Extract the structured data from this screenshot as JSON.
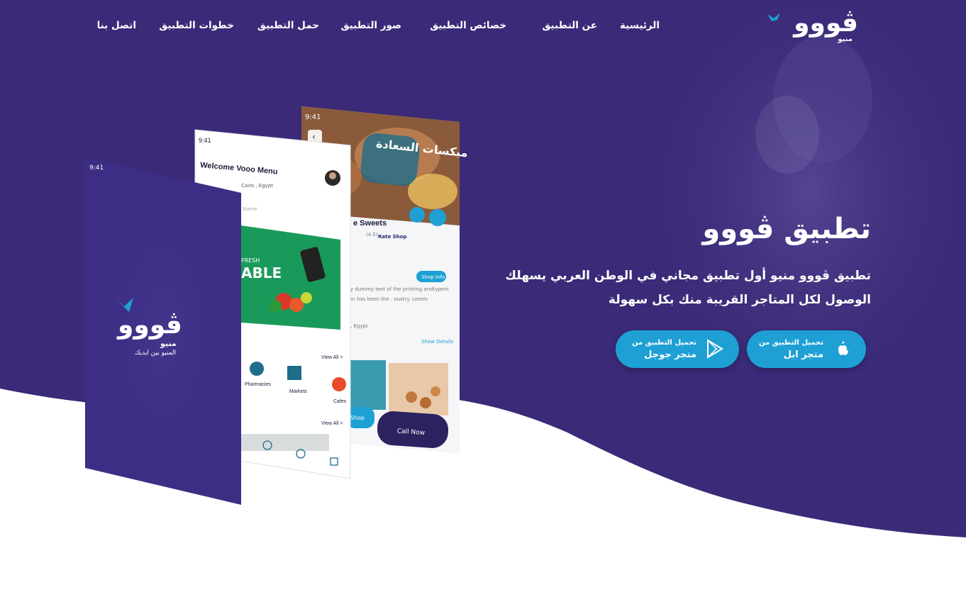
{
  "colors": {
    "brand_purple": "#3a2a78",
    "accent_blue": "#1ea0d4",
    "white": "#ffffff"
  },
  "logo": {
    "text": "ڤووو",
    "subtext": "منيو",
    "icon": "bird-icon"
  },
  "nav": {
    "items": [
      {
        "label": "الرئيسية"
      },
      {
        "label": "عن التطبيق"
      },
      {
        "label": "خصائص التطبيق"
      },
      {
        "label": "صور التطبيق"
      },
      {
        "label": "حمل التطبيق"
      },
      {
        "label": "خطوات التطبيق"
      },
      {
        "label": "اتصل بنا"
      }
    ]
  },
  "hero": {
    "title": "تطبيق ڤووو",
    "description": "تطبيق ڤووو منيو أول تطبيق مجاني في الوطن العربي يسهلك الوصول لكل المتاجر القريبة منك بكل سهولة",
    "buttons": [
      {
        "top": "تحميل التطبيق من",
        "bottom": "متجر ابل",
        "icon": "apple-icon"
      },
      {
        "top": "تحميل التطبيق من",
        "bottom": "متجر جوجل",
        "icon": "google-play-icon"
      }
    ]
  },
  "phone_splash": {
    "time": "9:41",
    "logo_text": "ڤووو",
    "logo_sub": "منيو",
    "tagline": "المنيو بين ايديك"
  },
  "phone_home": {
    "time": "9:41",
    "welcome": "Welcome Vooo Menu",
    "location": "Cairo , Egypt",
    "search_placeholder": "Name",
    "banner_text": "ABLE",
    "banner_small": "FRESH",
    "view_all_1": "View All >",
    "view_all_2": "View All >",
    "categories": [
      "Pharmacies",
      "Markets",
      "Cafes"
    ]
  },
  "phone_shop": {
    "time": "9:41",
    "shop_name": "e Sweets",
    "rating": "(4.5)",
    "rate_link": "Rate Shop",
    "info_button": "Shop Info",
    "description": "ly dummy text of the printing andtypein",
    "description2": "en has been the . oustry. Lorem",
    "location": ", Egypt",
    "show_details": "Show Details",
    "shop_button": "Shop",
    "call_button": "Call Now",
    "banner_title": "مبكسات السعادة"
  }
}
